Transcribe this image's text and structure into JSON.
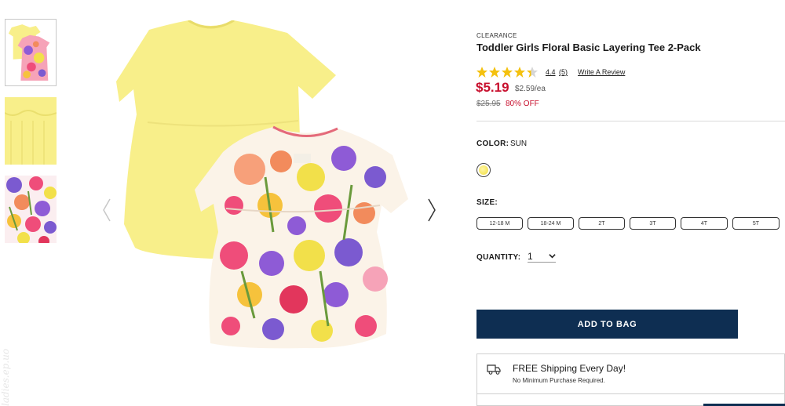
{
  "product": {
    "badge": "CLEARANCE",
    "title": "Toddler Girls Floral Basic Layering Tee 2-Pack",
    "rating": {
      "value": "4.4",
      "count": "(5)",
      "stars": 4.4,
      "write_review": "Write A Review"
    },
    "price": {
      "current": "$5.19",
      "per_each": "$2.59/ea",
      "original": "$25.95",
      "discount": "80% OFF"
    }
  },
  "options": {
    "color_label": "COLOR:",
    "color_value": "SUN",
    "size_label": "SIZE:",
    "sizes": [
      "12-18 M",
      "18-24 M",
      "2T",
      "3T",
      "4T",
      "5T"
    ],
    "quantity_label": "QUANTITY:",
    "quantity_value": "1"
  },
  "actions": {
    "add_to_bag": "ADD TO BAG"
  },
  "shipping": {
    "title": "FREE Shipping Every Day!",
    "subtitle": "No Minimum Purchase Required."
  },
  "watermark": "ladies.ep.uo",
  "colors": {
    "accent_red": "#c8102e",
    "button_navy": "#0e2e52",
    "star_gold": "#f4c10f",
    "shirt_yellow": "#f8ef8a"
  },
  "icons": [
    "chevron-left-icon",
    "chevron-right-icon",
    "star-icon",
    "chevron-down-icon",
    "truck-icon"
  ]
}
